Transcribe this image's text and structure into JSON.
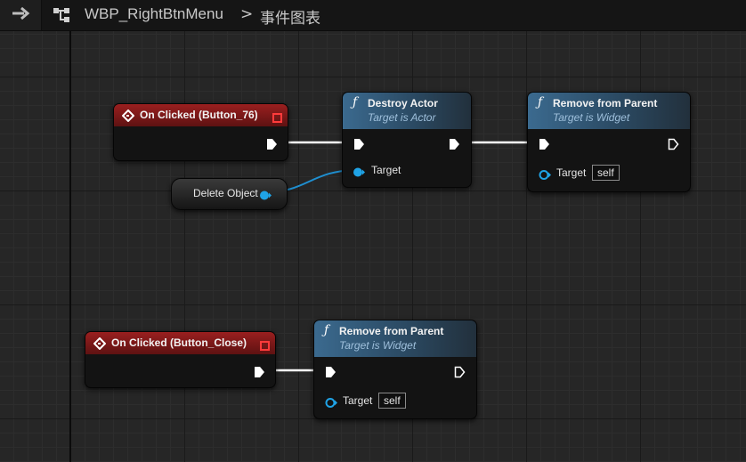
{
  "topbar": {
    "back_icon": "arrow-right-icon",
    "graph_icon": "graph-nodes-icon",
    "breadcrumb_title": "WBP_RightBtnMenu",
    "breadcrumb_separator": ">",
    "breadcrumb_graph": "事件图表"
  },
  "colors": {
    "event_header": "#8b1a1a",
    "function_header": "#3b6a8f",
    "object_pin": "#1fa3e6",
    "exec_pin": "#ffffff",
    "grid_bg": "#262626"
  },
  "nodes": {
    "on_clicked_76": {
      "title": "On Clicked (Button_76)",
      "icon": "event-diamond-icon",
      "delegate_icon": "delegate-square-icon"
    },
    "delete_object": {
      "label": "Delete Object"
    },
    "destroy_actor": {
      "title": "Destroy Actor",
      "subtitle": "Target is Actor",
      "icon": "function-f-icon",
      "pin_target": "Target"
    },
    "remove_parent_1": {
      "title": "Remove from Parent",
      "subtitle": "Target is Widget",
      "icon": "function-f-icon",
      "pin_target": "Target",
      "target_value": "self"
    },
    "on_clicked_close": {
      "title": "On Clicked (Button_Close)",
      "icon": "event-diamond-icon",
      "delegate_icon": "delegate-square-icon"
    },
    "remove_parent_2": {
      "title": "Remove from Parent",
      "subtitle": "Target is Widget",
      "icon": "function-f-icon",
      "pin_target": "Target",
      "target_value": "self"
    }
  }
}
